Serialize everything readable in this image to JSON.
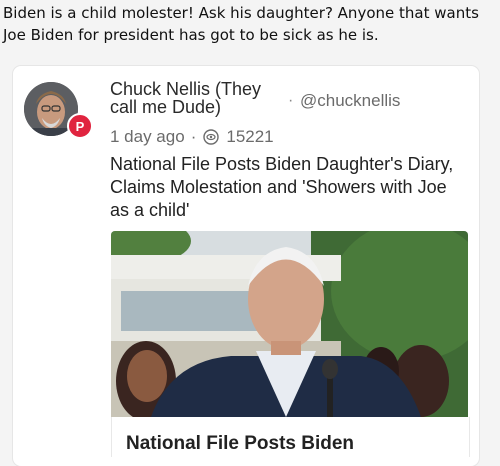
{
  "post_text": "Biden is a child molester! Ask his daughter? Anyone that wants Joe Biden for president has got to be sick as he is.",
  "card": {
    "author_name": "Chuck Nellis (They call me Dude)",
    "separator": "·",
    "handle": "@chucknellis",
    "time_ago": "1 day ago",
    "meta_separator": "·",
    "view_count": "15221",
    "headline": "National File Posts Biden Daughter's Diary, Claims Molestation and 'Showers with Joe as a child'",
    "avatar_icon": "avatar-photo",
    "badge_icon": "parler-icon",
    "badge_letter": "P",
    "badge_color": "#e0243f",
    "views_icon": "views-icon",
    "preview_title": "National File Posts Biden"
  }
}
